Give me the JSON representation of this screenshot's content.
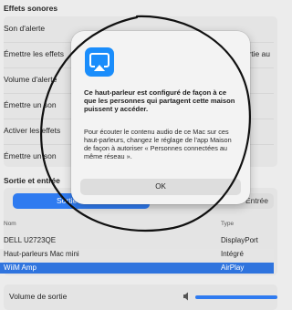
{
  "sound_effects": {
    "title": "Effets sonores",
    "rows": [
      {
        "label": "Son d'alerte"
      },
      {
        "label": "Émettre les effets",
        "right": "Sortie au"
      },
      {
        "label": "Volume d'alerte"
      },
      {
        "label": "Émettre un son"
      },
      {
        "label": "Activer les effets"
      },
      {
        "label": "Émettre un son"
      }
    ]
  },
  "output_input": {
    "title": "Sortie et entrée",
    "segments": [
      {
        "label": "Sortie"
      },
      {
        "label": "Entrée"
      }
    ],
    "table": {
      "headers": {
        "name": "Nom",
        "type": "Type"
      },
      "rows": [
        {
          "name": "DELL U2723QE",
          "type": "DisplayPort"
        },
        {
          "name": "Haut-parleurs Mac mini",
          "type": "Intégré"
        },
        {
          "name": "WiiM Amp",
          "type": "AirPlay"
        }
      ]
    },
    "volume_label": "Volume de sortie"
  },
  "dialog": {
    "icon": "airplay-icon",
    "title": "Ce haut-parleur est configuré de façon à ce que les personnes qui partagent cette maison puissent y accéder.",
    "body": "Pour écouter le contenu audio de ce Mac sur ces haut-parleurs, changez le réglage de l'app Maison de façon à autoriser « Personnes connectées au même réseau ».",
    "ok_label": "OK"
  },
  "colors": {
    "accent": "#2f7bf0",
    "selected_row": "#2f74de",
    "airplay_icon_bg": "#1a8dfb"
  }
}
